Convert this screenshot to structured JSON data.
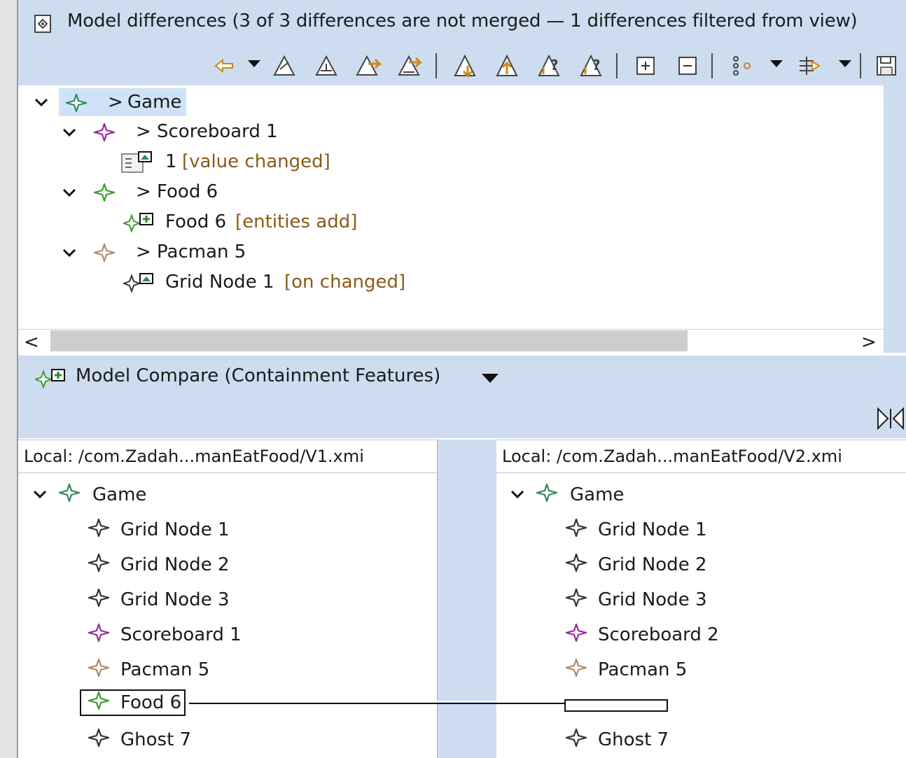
{
  "diff_view": {
    "title": "Model differences  (3 of 3 differences are not merged — 1 differences filtered from view)",
    "toolbar_icons": [
      "prev-diff-arrow-icon",
      "prev-dropdown-icon",
      "copy-current-left-icon",
      "copy-all-left-icon",
      "copy-current-right-icon",
      "copy-all-right-icon",
      "next-diff-icon",
      "prev-conflict-icon",
      "next-unresolved-icon",
      "prev-unresolved-icon",
      "expand-all-icon",
      "collapse-all-icon",
      "grouping-icon",
      "grouping-dropdown-icon",
      "filters-icon",
      "filters-dropdown-icon",
      "save-icon"
    ],
    "tree": [
      {
        "prefix": "> ",
        "label": "Game",
        "level": 0,
        "kind": "game",
        "expanded": true,
        "selected": true
      },
      {
        "prefix": "> ",
        "label": "Scoreboard 1",
        "level": 1,
        "kind": "scoreboard",
        "expanded": true
      },
      {
        "label": "1",
        "annotation": "[value changed]",
        "level": 2,
        "kind": "attr-change"
      },
      {
        "prefix": "> ",
        "label": "Food 6",
        "level": 1,
        "kind": "food",
        "expanded": true
      },
      {
        "label": "Food 6",
        "annotation": "[entities add]",
        "level": 2,
        "kind": "add"
      },
      {
        "prefix": "> ",
        "label": "Pacman 5",
        "level": 1,
        "kind": "pacman",
        "expanded": true
      },
      {
        "label": "Grid Node 1",
        "annotation": "[on changed]",
        "level": 2,
        "kind": "ref-change"
      }
    ],
    "hscroll_left": "<",
    "hscroll_right": ">"
  },
  "compare_view": {
    "title": "Model Compare (Containment Features)",
    "left_path": "Local: /com.Zadah...manEatFood/V1.xmi",
    "right_path": "Local: /com.Zadah...manEatFood/V2.xmi",
    "left_tree": {
      "root": "Game",
      "children": [
        {
          "label": "Grid Node 1",
          "kind": "node"
        },
        {
          "label": "Grid Node 2",
          "kind": "node"
        },
        {
          "label": "Grid Node 3",
          "kind": "node"
        },
        {
          "label": "Scoreboard 1",
          "kind": "scoreboard"
        },
        {
          "label": "Pacman 5",
          "kind": "pacman"
        },
        {
          "label": "Food 6",
          "kind": "food",
          "highlighted": true
        },
        {
          "label": "Ghost 7",
          "kind": "node"
        }
      ]
    },
    "right_tree": {
      "root": "Game",
      "children": [
        {
          "label": "Grid Node 1",
          "kind": "node"
        },
        {
          "label": "Grid Node 2",
          "kind": "node"
        },
        {
          "label": "Grid Node 3",
          "kind": "node"
        },
        {
          "label": "Scoreboard 2",
          "kind": "scoreboard"
        },
        {
          "label": "Pacman 5",
          "kind": "pacman"
        },
        {
          "label": "",
          "kind": "placeholder"
        },
        {
          "label": "Ghost 7",
          "kind": "node"
        }
      ]
    }
  },
  "colors": {
    "header_bg": "#cddcef",
    "game": "#2f8a5a",
    "scoreboard": "#9a2a9a",
    "food": "#3f9a2f",
    "pacman": "#b08a6a",
    "node": "#333333",
    "selection": "#cfe3f8"
  }
}
